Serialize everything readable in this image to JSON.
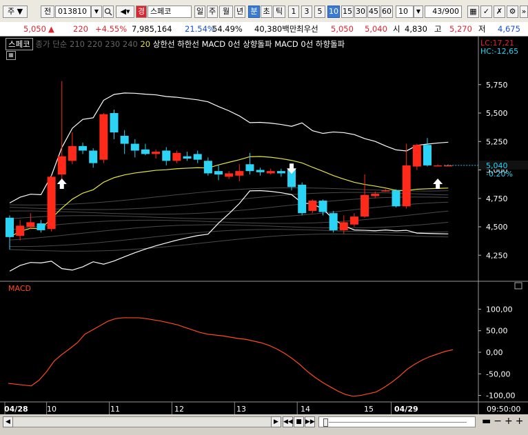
{
  "toolbar": {
    "market": "주",
    "prev_label": "전",
    "code": "013810",
    "sound_icon": "speaker-icon",
    "warn_badge": "경",
    "name": "스페코",
    "periods": [
      "일",
      "주",
      "월",
      "년",
      "분",
      "초",
      "틱"
    ],
    "active_period": "분",
    "intervals": [
      "1",
      "3",
      "5",
      "10",
      "15",
      "30",
      "45",
      "60"
    ],
    "active_interval": "10",
    "count": "10",
    "page": "43/900"
  },
  "info": {
    "price": "5,050",
    "change": "220",
    "change_pct": "+4.55%",
    "volume": "7,985,164",
    "vol_ratio": "21.54%",
    "ratio2": "54.49%",
    "amount": "40,380백만",
    "best_label": "최우선",
    "ask": "5,050",
    "bid": "5,040",
    "open_label": "시",
    "open": "4,830",
    "high_label": "고",
    "high": "5,270",
    "low_label": "저",
    "low": "4,675"
  },
  "legend": {
    "name": "스페코",
    "ma_label": "종가 단순",
    "ma_periods": [
      "210",
      "220",
      "230",
      "240"
    ],
    "ma_active": "20",
    "items": [
      "상한선",
      "하한선",
      "MACD 0선 상향돌파",
      "MACD 0선 하향돌파"
    ]
  },
  "lc": "LC:17,21",
  "hc": "HC:-12,65",
  "price_axis": {
    "ticks": [
      "5,750",
      "5,500",
      "5,250",
      "5,000",
      "4,750",
      "4,500",
      "4,250"
    ],
    "current": "5,040",
    "current_pct": "-0.20%"
  },
  "macd": {
    "label": "MACD",
    "ticks": [
      "100,00",
      "50,00",
      "0,00",
      "-50,00",
      "-100,00"
    ],
    "values": [
      -72,
      -74,
      -76,
      -78,
      -65,
      -45,
      -20,
      -5,
      8,
      22,
      42,
      52,
      62,
      72,
      78,
      80,
      80,
      80,
      78,
      75,
      72,
      68,
      64,
      58,
      52,
      46,
      42,
      40,
      38,
      35,
      32,
      30,
      26,
      22,
      16,
      8,
      -2,
      -14,
      -28,
      -44,
      -58,
      -70,
      -80,
      -90,
      -98,
      -102,
      -100,
      -96,
      -92,
      -82,
      -70,
      -56,
      -40,
      -28,
      -18,
      -10,
      -4,
      2,
      6
    ]
  },
  "time_axis": {
    "labels": [
      "04/28",
      "10",
      "11",
      "12",
      "13",
      "14",
      "15",
      "04/29"
    ],
    "clock": "09:50:00"
  },
  "candles": [
    {
      "o": 4580,
      "c": 4410,
      "h": 4600,
      "l": 4300
    },
    {
      "o": 4420,
      "c": 4510,
      "h": 4560,
      "l": 4380
    },
    {
      "o": 4500,
      "c": 4540,
      "h": 4620,
      "l": 4480
    },
    {
      "o": 4530,
      "c": 4470,
      "h": 4560,
      "l": 4450
    },
    {
      "o": 4480,
      "c": 4940,
      "h": 4950,
      "l": 4460
    },
    {
      "o": 4960,
      "c": 5120,
      "h": 5780,
      "l": 4900
    },
    {
      "o": 5080,
      "c": 5210,
      "h": 5330,
      "l": 5050
    },
    {
      "o": 5210,
      "c": 5170,
      "h": 5240,
      "l": 5140
    },
    {
      "o": 5170,
      "c": 5060,
      "h": 5190,
      "l": 5020
    },
    {
      "o": 5090,
      "c": 5490,
      "h": 5500,
      "l": 5060
    },
    {
      "o": 5500,
      "c": 5330,
      "h": 5530,
      "l": 5270
    },
    {
      "o": 5300,
      "c": 5230,
      "h": 5350,
      "l": 5140
    },
    {
      "o": 5230,
      "c": 5170,
      "h": 5270,
      "l": 5110
    },
    {
      "o": 5180,
      "c": 5140,
      "h": 5230,
      "l": 5130
    },
    {
      "o": 5140,
      "c": 5160,
      "h": 5180,
      "l": 5100
    },
    {
      "o": 5170,
      "c": 5080,
      "h": 5200,
      "l": 5040
    },
    {
      "o": 5080,
      "c": 5150,
      "h": 5170,
      "l": 5060
    },
    {
      "o": 5120,
      "c": 5100,
      "h": 5160,
      "l": 5080
    },
    {
      "o": 5140,
      "c": 5090,
      "h": 5170,
      "l": 5060
    },
    {
      "o": 5080,
      "c": 4970,
      "h": 5110,
      "l": 4950
    },
    {
      "o": 4990,
      "c": 4960,
      "h": 5040,
      "l": 4910
    },
    {
      "o": 4940,
      "c": 4970,
      "h": 4990,
      "l": 4920
    },
    {
      "o": 4950,
      "c": 4990,
      "h": 5050,
      "l": 4900
    },
    {
      "o": 5050,
      "c": 4990,
      "h": 5150,
      "l": 4960
    },
    {
      "o": 5000,
      "c": 4980,
      "h": 5020,
      "l": 4950
    },
    {
      "o": 4970,
      "c": 4990,
      "h": 5010,
      "l": 4960
    },
    {
      "o": 4990,
      "c": 4970,
      "h": 5010,
      "l": 4940
    },
    {
      "o": 5010,
      "c": 4850,
      "h": 5050,
      "l": 4820
    },
    {
      "o": 4870,
      "c": 4620,
      "h": 4890,
      "l": 4600
    },
    {
      "o": 4640,
      "c": 4730,
      "h": 4740,
      "l": 4620
    },
    {
      "o": 4730,
      "c": 4630,
      "h": 4740,
      "l": 4600
    },
    {
      "o": 4620,
      "c": 4470,
      "h": 4640,
      "l": 4450
    },
    {
      "o": 4470,
      "c": 4540,
      "h": 4600,
      "l": 4440
    },
    {
      "o": 4520,
      "c": 4590,
      "h": 4620,
      "l": 4500
    },
    {
      "o": 4590,
      "c": 4780,
      "h": 4960,
      "l": 4580
    },
    {
      "o": 4770,
      "c": 4790,
      "h": 4810,
      "l": 4750
    },
    {
      "o": 4820,
      "c": 4820,
      "h": 4830,
      "l": 4810
    },
    {
      "o": 4820,
      "c": 4680,
      "h": 4830,
      "l": 4670
    },
    {
      "o": 4680,
      "c": 5040,
      "h": 5230,
      "l": 4660
    },
    {
      "o": 5030,
      "c": 5220,
      "h": 5230,
      "l": 5000
    },
    {
      "o": 5220,
      "c": 5040,
      "h": 5280,
      "l": 5030
    },
    {
      "o": 5040,
      "c": 5040,
      "h": 5050,
      "l": 5040
    },
    {
      "o": 5040,
      "c": 5040,
      "h": 5050,
      "l": 5040
    }
  ],
  "signals": [
    {
      "i": 5,
      "dir": "up",
      "v": 4870
    },
    {
      "i": 27,
      "dir": "down",
      "v": 5020
    },
    {
      "i": 41,
      "dir": "up",
      "v": 4870
    }
  ],
  "colors": {
    "up": "#ff2a1a",
    "down": "#2bd4f5",
    "bg": "#000000",
    "macd_line": "#ff4a20",
    "upper": "#ffffff",
    "ma": "#e6e63a"
  }
}
